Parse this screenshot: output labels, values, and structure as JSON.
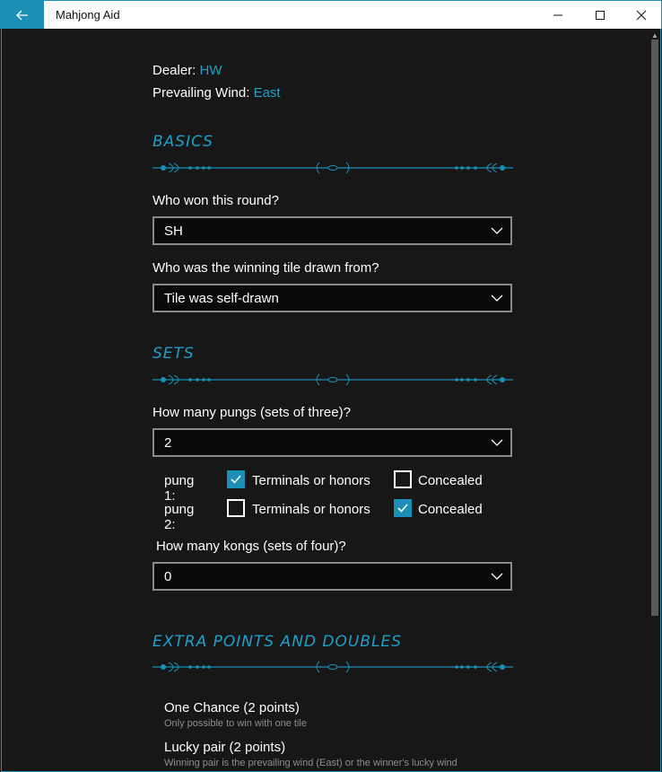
{
  "window": {
    "title": "Mahjong Aid",
    "icons": [
      "back-arrow-icon",
      "minimize-icon",
      "maximize-icon",
      "close-icon"
    ]
  },
  "header": {
    "dealer_label": "Dealer:",
    "dealer_value": "HW",
    "wind_label": "Prevailing Wind:",
    "wind_value": "East"
  },
  "basics": {
    "title": "BASICS",
    "winner_question": "Who won this round?",
    "winner_value": "SH",
    "tile_question": "Who was the winning tile drawn from?",
    "tile_value": "Tile was self-drawn"
  },
  "sets": {
    "title": "SETS",
    "pungs_question": "How many pungs (sets of three)?",
    "pungs_value": "2",
    "pungs": [
      {
        "label": "pung 1:",
        "terminals_label": "Terminals or honors",
        "terminals_checked": true,
        "concealed_label": "Concealed",
        "concealed_checked": false
      },
      {
        "label": "pung 2:",
        "terminals_label": "Terminals or honors",
        "terminals_checked": false,
        "concealed_label": "Concealed",
        "concealed_checked": true
      }
    ],
    "kongs_question": "How many kongs (sets of four)?",
    "kongs_value": "0"
  },
  "extras": {
    "title": "EXTRA POINTS AND DOUBLES",
    "items": [
      {
        "title": "One Chance (2 points)",
        "desc": "Only possible to win with one tile"
      },
      {
        "title": "Lucky pair (2 points)",
        "desc": "Winning pair is the prevailing wind (East) or the winner's lucky wind"
      }
    ]
  },
  "colors": {
    "accent": "#1b8fb6",
    "accent_text": "#1f9fc9",
    "background": "#171717"
  }
}
